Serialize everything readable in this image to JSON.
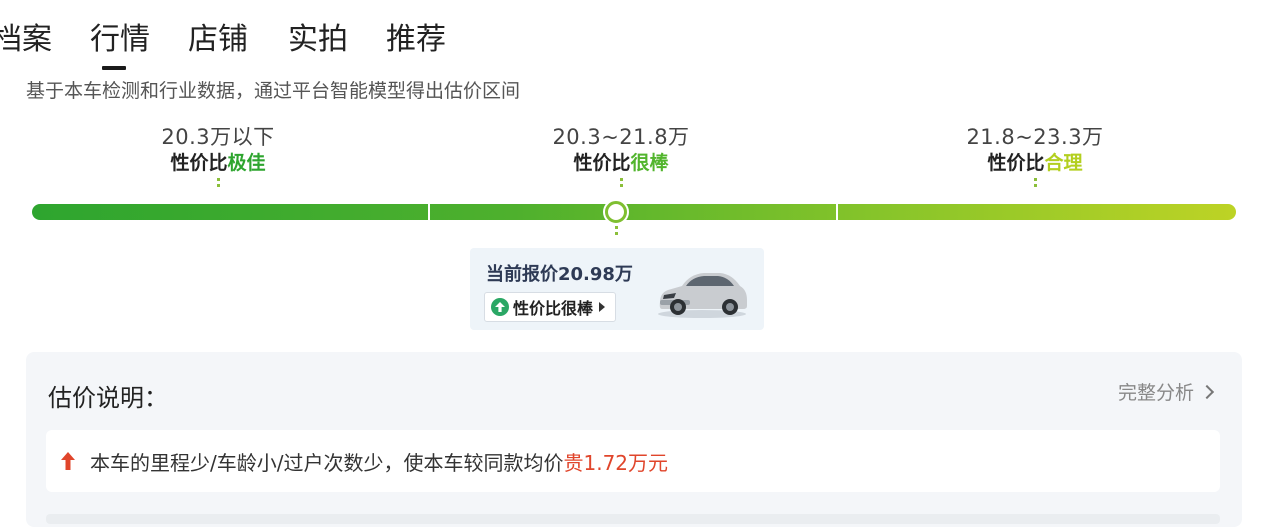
{
  "tabs": [
    {
      "label": "档案"
    },
    {
      "label": "行情"
    },
    {
      "label": "店铺"
    },
    {
      "label": "实拍"
    },
    {
      "label": "推荐"
    }
  ],
  "active_tab": "行情",
  "subtitle": "基于本车检测和行业数据，通过平台智能模型得出估价区间",
  "segments": [
    {
      "range": "20.3万以下",
      "rating_prefix": "性价比",
      "rating_value": "极佳",
      "color": "#2ea52f"
    },
    {
      "range": "20.3~21.8万",
      "rating_prefix": "性价比",
      "rating_value": "很棒",
      "color": "#52b52d"
    },
    {
      "range": "21.8~23.3万",
      "rating_prefix": "性价比",
      "rating_value": "合理",
      "color": "#b3cf1f"
    }
  ],
  "current_price": {
    "label": "当前报价20.98万",
    "badge": "性价比很棒",
    "badge_icon": "up-arrow-circle-icon",
    "image": "silver-suv-car"
  },
  "estimate": {
    "title": "估价说明：",
    "link": "完整分析",
    "reason_prefix": "本车的里程少/车龄小/过户次数少，使本车较同款均价",
    "reason_highlight": "贵1.72万元",
    "reason_icon": "red-up-arrow-icon",
    "highlight_color": "#e0452b"
  }
}
